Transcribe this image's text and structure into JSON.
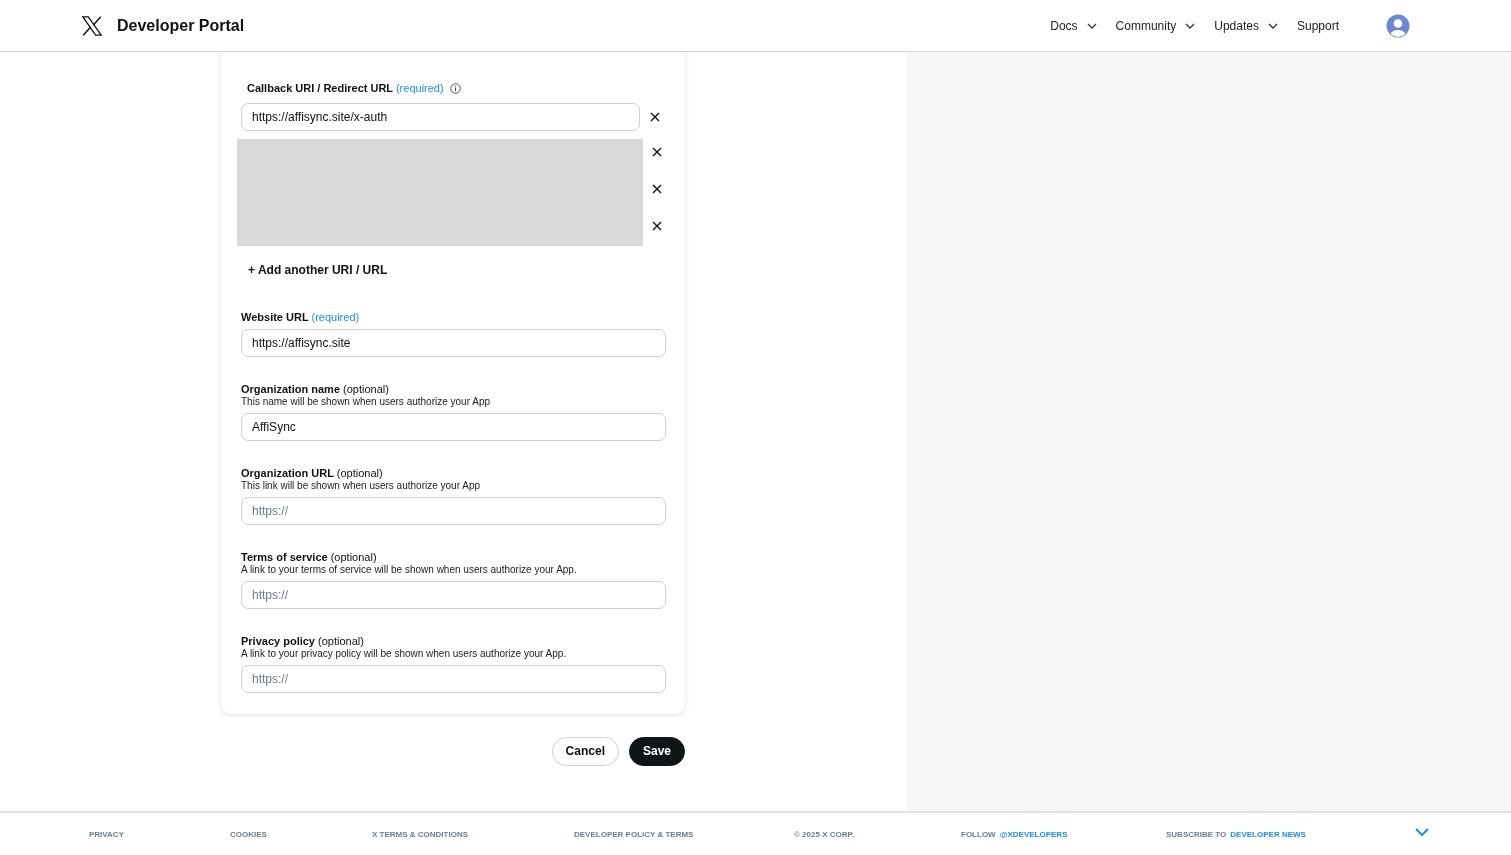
{
  "header": {
    "title": "Developer Portal",
    "nav": [
      {
        "label": "Docs",
        "dropdown": true
      },
      {
        "label": "Community",
        "dropdown": true
      },
      {
        "label": "Updates",
        "dropdown": true
      },
      {
        "label": "Support",
        "dropdown": false
      }
    ]
  },
  "callback": {
    "label": "Callback URI / Redirect URL",
    "tag": "(required)",
    "required": true,
    "urls": [
      {
        "kind": "text",
        "value": "https://affisync.site/x-auth"
      },
      {
        "kind": "redacted"
      },
      {
        "kind": "redacted"
      },
      {
        "kind": "redacted"
      }
    ],
    "add_label": "+ Add another URI / URL"
  },
  "fields": [
    {
      "label": "Website URL",
      "tag": "(required)",
      "required": true,
      "value": "https://affisync.site"
    },
    {
      "label": "Organization name",
      "tag": "(optional)",
      "required": false,
      "hint": "This name will be shown when users authorize your App",
      "value": "AffiSync"
    },
    {
      "label": "Organization URL",
      "tag": "(optional)",
      "required": false,
      "hint": "This link will be shown when users authorize your App",
      "placeholder": "https://"
    },
    {
      "label": "Terms of service",
      "tag": "(optional)",
      "required": false,
      "hint": "A link to your terms of service will be shown when users authorize your App.",
      "placeholder": "https://"
    },
    {
      "label": "Privacy policy",
      "tag": "(optional)",
      "required": false,
      "hint": "A link to your privacy policy will be shown when users authorize your App.",
      "placeholder": "https://"
    }
  ],
  "buttons": [
    {
      "label": "Cancel",
      "kind": "secondary"
    },
    {
      "label": "Save",
      "kind": "primary"
    }
  ],
  "footer": [
    {
      "text": "PRIVACY"
    },
    {
      "text": "COOKIES"
    },
    {
      "text": "X TERMS & CONDITIONS"
    },
    {
      "text": "DEVELOPER POLICY & TERMS"
    },
    {
      "text": "© 2025 X CORP."
    },
    {
      "text": "FOLLOW",
      "link": "@XDEVELOPERS"
    },
    {
      "text": "SUBSCRIBE TO",
      "link": "DEVELOPER NEWS"
    }
  ]
}
